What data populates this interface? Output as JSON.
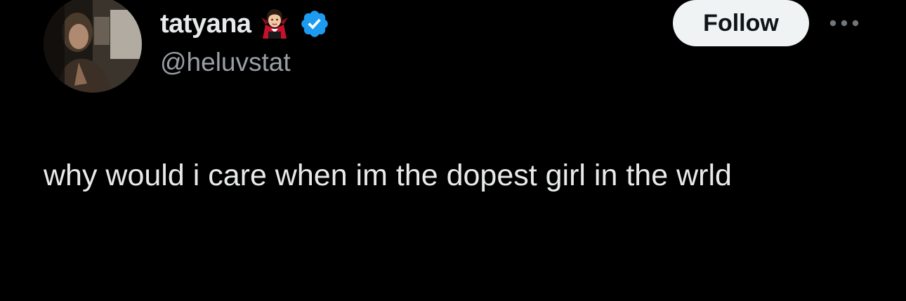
{
  "user": {
    "display_name": "tatyana",
    "handle": "@heluvstat",
    "name_emoji": "vampire-woman-icon",
    "verified": true,
    "verified_color": "#1d9bf0"
  },
  "actions": {
    "follow_label": "Follow",
    "more_icon": "more-horizontal-icon"
  },
  "tweet": {
    "text": "why would i care when im the dopest girl in the wrld"
  },
  "colors": {
    "background": "#000000",
    "text_primary": "#e7e9ea",
    "text_secondary": "#9a9ea3",
    "follow_bg": "#eff3f4",
    "follow_text": "#0f1419"
  }
}
